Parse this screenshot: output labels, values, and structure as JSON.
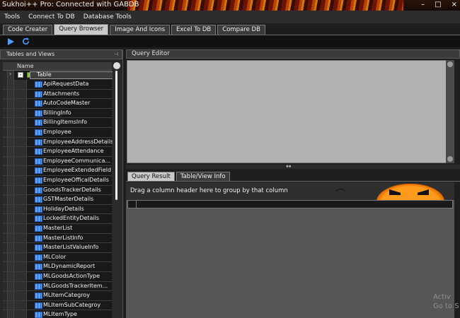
{
  "window": {
    "title": "Sukhoi++ Pro: Connected with GABDB",
    "controls": [
      "–",
      "□",
      "×"
    ]
  },
  "menu": [
    "Tools",
    "Connect To DB",
    "Database Tools"
  ],
  "tabs": [
    {
      "label": "Code Creater",
      "active": false
    },
    {
      "label": "Query Browser",
      "active": true
    },
    {
      "label": "Image And Icons",
      "active": false
    },
    {
      "label": "Excel To DB",
      "active": false
    },
    {
      "label": "Compare DB",
      "active": false
    }
  ],
  "toolbar": {
    "run_icon": "play-icon",
    "refresh_icon": "refresh-icon"
  },
  "left_panel": {
    "title": "Tables and Views",
    "pin_icon": "pin-icon",
    "column_header": "Name",
    "root": "Table",
    "tables": [
      "ApiRequestData",
      "Attachments",
      "AutoCodeMaster",
      "BillingInfo",
      "BillingItemsInfo",
      "Employee",
      "EmployeeAddressDetails",
      "EmployeeAttendance",
      "EmployeeCommunica...",
      "EmployeeExtendedField",
      "EmployeeOfficalDetails",
      "GoodsTrackerDetails",
      "GSTMasterDetails",
      "HolidayDetails",
      "LockedEntityDetails",
      "MasterList",
      "MasterListInfo",
      "MasterListValueInfo",
      "MLColor",
      "MLDynamicReport",
      "MLGoodsActionType",
      "MLGoodsTrackerItem...",
      "MLItemCategroy",
      "MLItemSubCategroy",
      "MLItemType"
    ]
  },
  "query_editor": {
    "title": "Query Editor",
    "text": ""
  },
  "result_tabs": [
    {
      "label": "Query Result",
      "active": true
    },
    {
      "label": "Table/View Info",
      "active": false
    }
  ],
  "result": {
    "group_hint": "Drag a column header here to group by that column"
  },
  "watermark": {
    "line1": "Activ",
    "line2": "Go to S"
  },
  "colors": {
    "accent_orange": "#f08a10",
    "table_icon": "#5aa0ff",
    "editor_bg": "#b2b2b2"
  }
}
